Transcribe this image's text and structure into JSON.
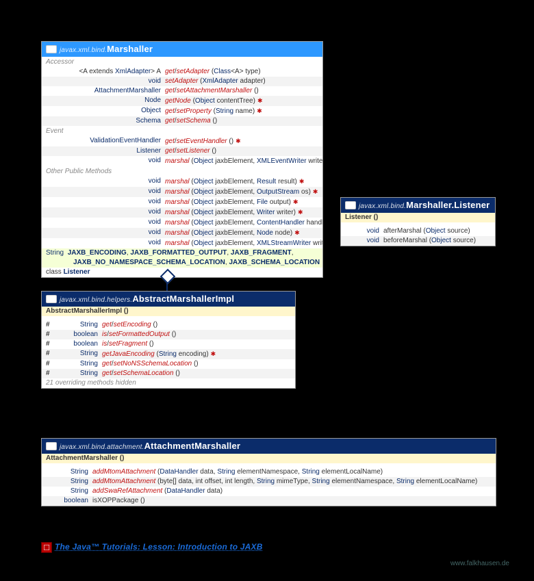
{
  "marshaller": {
    "pkg": "javax.xml.bind.",
    "name": "Marshaller",
    "sections": {
      "accessor": "Accessor",
      "event": "Event",
      "other": "Other Public Methods"
    },
    "rows": {
      "r0": {
        "ret": "<A extends XmlAdapter> A",
        "sig": "get/setAdapter (Class<A> type)",
        "red": "get/setAdapter"
      },
      "r1": {
        "ret": "void",
        "sig": "setAdapter (XmlAdapter adapter)",
        "red": "setAdapter"
      },
      "r2": {
        "ret": "AttachmentMarshaller",
        "sig": "get/setAttachmentMarshaller ()",
        "red": "get/setAttachmentMarshaller"
      },
      "r3": {
        "ret": "Node",
        "sig": "getNode (Object contentTree) ✱",
        "red": "getNode"
      },
      "r4": {
        "ret": "Object",
        "sig": "get/setProperty (String name) ✱",
        "red": "get/setProperty"
      },
      "r5": {
        "ret": "Schema",
        "sig": "get/setSchema ()",
        "red": "get/setSchema"
      },
      "r6": {
        "ret": "ValidationEventHandler",
        "sig": "get/setEventHandler () ✱",
        "red": "get/setEventHandler"
      },
      "r7": {
        "ret": "Listener",
        "sig": "get/setListener ()",
        "red": "get/setListener"
      },
      "r8": {
        "ret": "void",
        "sig": "marshal (Object jaxbElement, XMLEventWriter writer) ✱",
        "red": "marshal"
      },
      "r9": {
        "ret": "void",
        "sig": "marshal (Object jaxbElement, Result result) ✱",
        "red": "marshal"
      },
      "r10": {
        "ret": "void",
        "sig": "marshal (Object jaxbElement, OutputStream os) ✱",
        "red": "marshal"
      },
      "r11": {
        "ret": "void",
        "sig": "marshal (Object jaxbElement, File output) ✱",
        "red": "marshal"
      },
      "r12": {
        "ret": "void",
        "sig": "marshal (Object jaxbElement, Writer writer) ✱",
        "red": "marshal"
      },
      "r13": {
        "ret": "void",
        "sig": "marshal (Object jaxbElement, ContentHandler handler) ✱",
        "red": "marshal"
      },
      "r14": {
        "ret": "void",
        "sig": "marshal (Object jaxbElement, Node node) ✱",
        "red": "marshal"
      },
      "r15": {
        "ret": "void",
        "sig": "marshal (Object jaxbElement, XMLStreamWriter writer) ✱",
        "red": "marshal"
      }
    },
    "const1": "String  JAXB_ENCODING, JAXB_FORMATTED_OUTPUT, JAXB_FRAGMENT,",
    "const2": "JAXB_NO_NAMESPACE_SCHEMA_LOCATION, JAXB_SCHEMA_LOCATION",
    "cls": "class Listener"
  },
  "listener": {
    "pkg": "javax.xml.bind.",
    "name": "Marshaller.Listener",
    "ctor": "Listener ()",
    "r0": {
      "ret": "void",
      "sig": "afterMarshal (Object source)"
    },
    "r1": {
      "ret": "void",
      "sig": "beforeMarshal (Object source)"
    }
  },
  "impl": {
    "pkg": "javax.xml.bind.helpers.",
    "name": "AbstractMarshallerImpl",
    "ctor": "AbstractMarshallerImpl ()",
    "r0": {
      "vis": "#",
      "ret": "String",
      "sig": "get/setEncoding ()",
      "red": "get/setEncoding"
    },
    "r1": {
      "vis": "#",
      "ret": "boolean",
      "sig": "is/setFormattedOutput ()",
      "red": "is/setFormattedOutput"
    },
    "r2": {
      "vis": "#",
      "ret": "boolean",
      "sig": "is/setFragment ()",
      "red": "is/setFragment"
    },
    "r3": {
      "vis": "#",
      "ret": "String",
      "sig": "getJavaEncoding (String encoding) ✱",
      "red": "getJavaEncoding"
    },
    "r4": {
      "vis": "#",
      "ret": "String",
      "sig": "get/setNoNSSchemaLocation ()",
      "red": "get/setNoNSSchemaLocation"
    },
    "r5": {
      "vis": "#",
      "ret": "String",
      "sig": "get/setSchemaLocation ()",
      "red": "get/setSchemaLocation"
    },
    "note": "21 overriding methods hidden"
  },
  "attach": {
    "pkg": "javax.xml.bind.attachment.",
    "name": "AttachmentMarshaller",
    "ctor": "AttachmentMarshaller ()",
    "r0": {
      "ret": "String",
      "sig": "addMtomAttachment (DataHandler data, String elementNamespace, String elementLocalName)",
      "red": "addMtomAttachment"
    },
    "r1": {
      "ret": "String",
      "sig": "addMtomAttachment (byte[] data, int offset, int length, String mimeType, String elementNamespace, String elementLocalName)",
      "red": "addMtomAttachment"
    },
    "r2": {
      "ret": "String",
      "sig": "addSwaRefAttachment (DataHandler data)",
      "red": "addSwaRefAttachment"
    },
    "r3": {
      "ret": "boolean",
      "sig": "isXOPPackage ()",
      "red": ""
    }
  },
  "link": {
    "icon": "□",
    "label": "The Java™ Tutorials: Lesson: Introduction to JAXB"
  },
  "footer": "www.falkhausen.de"
}
